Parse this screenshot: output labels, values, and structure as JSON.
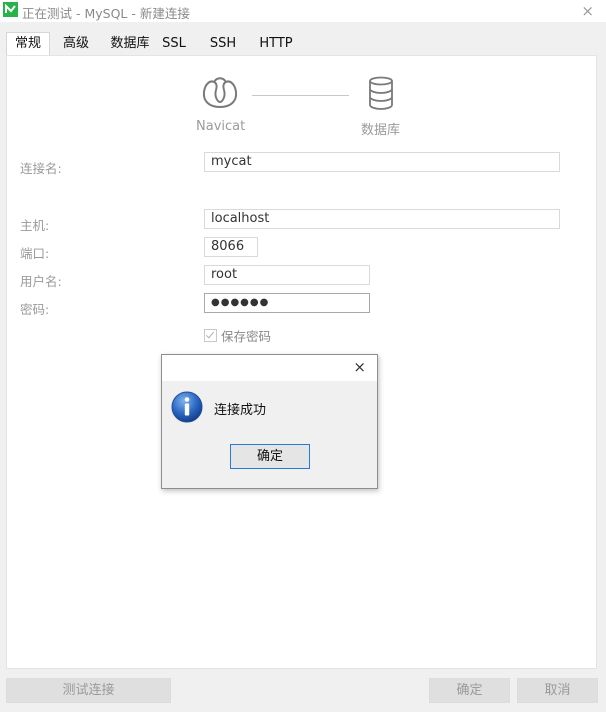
{
  "window": {
    "title": "正在测试 - MySQL - 新建连接",
    "close_glyph": "×",
    "app_icon": "navicat-app-icon",
    "accent_color": "#27b24a"
  },
  "tabs": [
    {
      "label": "常规",
      "active": true
    },
    {
      "label": "高级",
      "active": false
    },
    {
      "label": "数据库",
      "active": false
    },
    {
      "label": "SSL",
      "active": false
    },
    {
      "label": "SSH",
      "active": false
    },
    {
      "label": "HTTP",
      "active": false
    }
  ],
  "graphic": {
    "left_label": "Navicat",
    "right_label": "数据库",
    "left_icon": "navicat-logo-icon",
    "right_icon": "database-icon"
  },
  "form": {
    "connection_name": {
      "label": "连接名:",
      "value": "mycat"
    },
    "host": {
      "label": "主机:",
      "value": "localhost"
    },
    "port": {
      "label": "端口:",
      "value": "8066"
    },
    "username": {
      "label": "用户名:",
      "value": "root"
    },
    "password": {
      "label": "密码:",
      "value": "●●●●●●"
    },
    "save_password": {
      "label": "保存密码",
      "checked": true
    }
  },
  "dialog": {
    "message": "连接成功",
    "ok_label": "确定",
    "close_glyph": "×",
    "icon": "info-icon"
  },
  "buttons": {
    "test_connection": "测试连接",
    "ok": "确定",
    "cancel": "取消"
  }
}
